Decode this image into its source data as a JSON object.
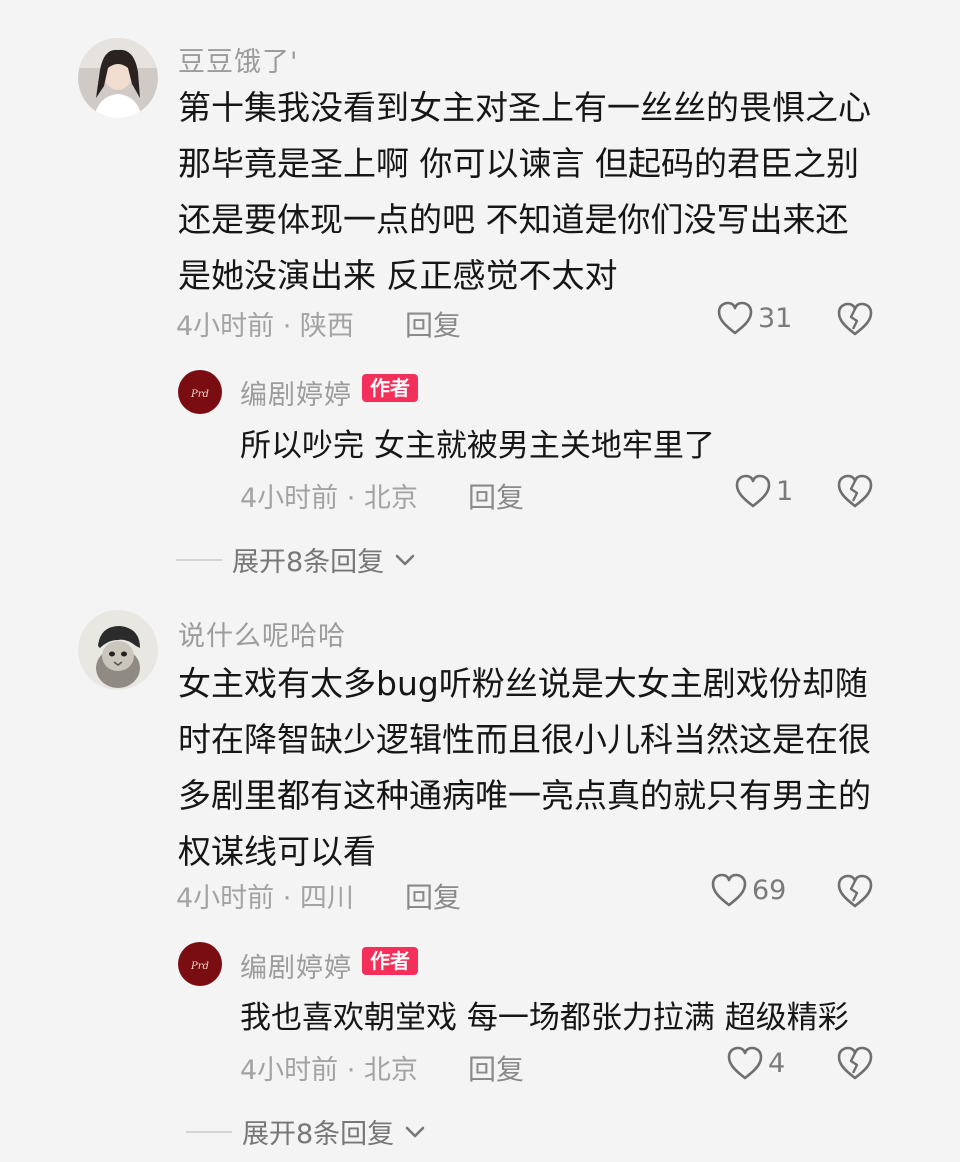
{
  "comments": [
    {
      "username": "豆豆饿了'",
      "lines": [
        "第十集我没看到女主对圣上有一丝丝的畏惧之心",
        "那毕竟是圣上啊 你可以谏言 但起码的君臣之别",
        "还是要体现一点的吧  不知道是你们没写出来还",
        "是她没演出来 反正感觉不太对"
      ],
      "meta": "4小时前 · 陕西",
      "reply_label": "回复",
      "likes": "31",
      "author_reply": {
        "username": "编剧婷婷",
        "badge": "作者",
        "text": "所以吵完 女主就被男主关地牢里了",
        "meta": "4小时前 · 北京",
        "reply_label": "回复",
        "likes": "1"
      },
      "expand_label": "展开8条回复"
    },
    {
      "username": "说什么呢哈哈",
      "lines": [
        "女主戏有太多bug听粉丝说是大女主剧戏份却随",
        "时在降智缺少逻辑性而且很小儿科当然这是在很",
        "多剧里都有这种通病唯一亮点真的就只有男主的",
        "权谋线可以看"
      ],
      "meta": "4小时前 · 四川",
      "reply_label": "回复",
      "likes": "69",
      "author_reply": {
        "username": "编剧婷婷",
        "badge": "作者",
        "text": "我也喜欢朝堂戏 每一场都张力拉满 超级精彩",
        "meta": "4小时前 · 北京",
        "reply_label": "回复",
        "likes": "4"
      },
      "expand_label": "展开8条回复"
    }
  ],
  "colors": {
    "author_badge": "#f2305a",
    "background": "#f4f4f4"
  },
  "icons": {
    "like": "heart-outline-icon",
    "dislike": "broken-heart-icon",
    "expand": "chevron-down-icon"
  }
}
